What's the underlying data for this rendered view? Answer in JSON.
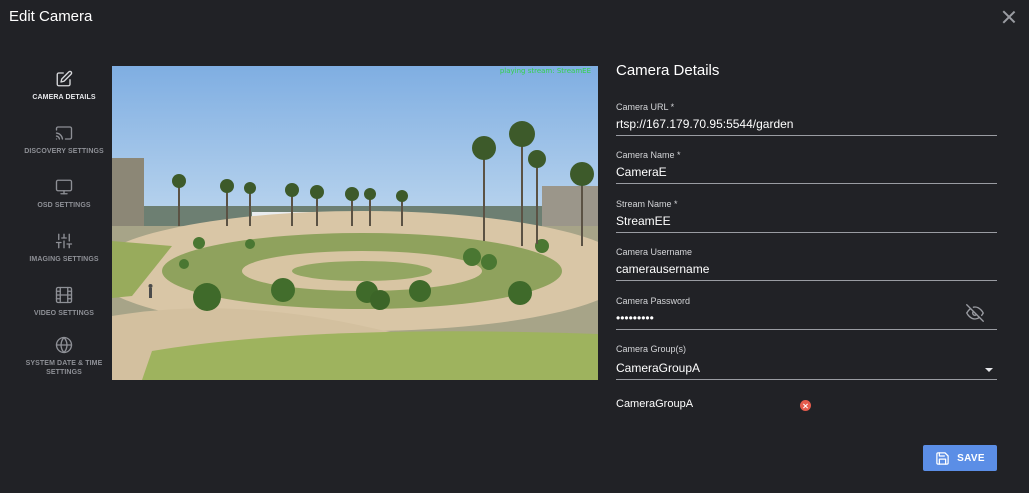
{
  "dialog": {
    "title": "Edit Camera"
  },
  "sidebar": {
    "items": [
      {
        "label": "CAMERA DETAILS",
        "icon": "edit-icon",
        "active": true
      },
      {
        "label": "DISCOVERY SETTINGS",
        "icon": "cast-icon",
        "active": false
      },
      {
        "label": "OSD SETTINGS",
        "icon": "monitor-icon",
        "active": false
      },
      {
        "label": "IMAGING SETTINGS",
        "icon": "sliders-icon",
        "active": false
      },
      {
        "label": "VIDEO SETTINGS",
        "icon": "film-icon",
        "active": false
      },
      {
        "label": "SYSTEM DATE & TIME SETTINGS",
        "icon": "globe-icon",
        "active": false
      }
    ]
  },
  "video": {
    "overlay": "playing stream: StreamEE"
  },
  "form": {
    "title": "Camera Details",
    "camera_url": {
      "label": "Camera URL *",
      "value": "rtsp://167.179.70.95:5544/garden"
    },
    "camera_name": {
      "label": "Camera Name *",
      "value": "CameraE"
    },
    "stream_name": {
      "label": "Stream Name *",
      "value": "StreamEE"
    },
    "camera_username": {
      "label": "Camera Username",
      "value": "camerausername"
    },
    "camera_password": {
      "label": "Camera Password",
      "value": "•••••••••"
    },
    "camera_groups": {
      "label": "Camera Group(s)",
      "value": "CameraGroupA"
    },
    "selected_group_chip": "CameraGroupA"
  },
  "actions": {
    "save_label": "SAVE"
  },
  "colors": {
    "background": "#212226",
    "accent": "#5b8ee6",
    "chip_remove": "#e45b4c",
    "overlay_text": "#33d24a"
  }
}
